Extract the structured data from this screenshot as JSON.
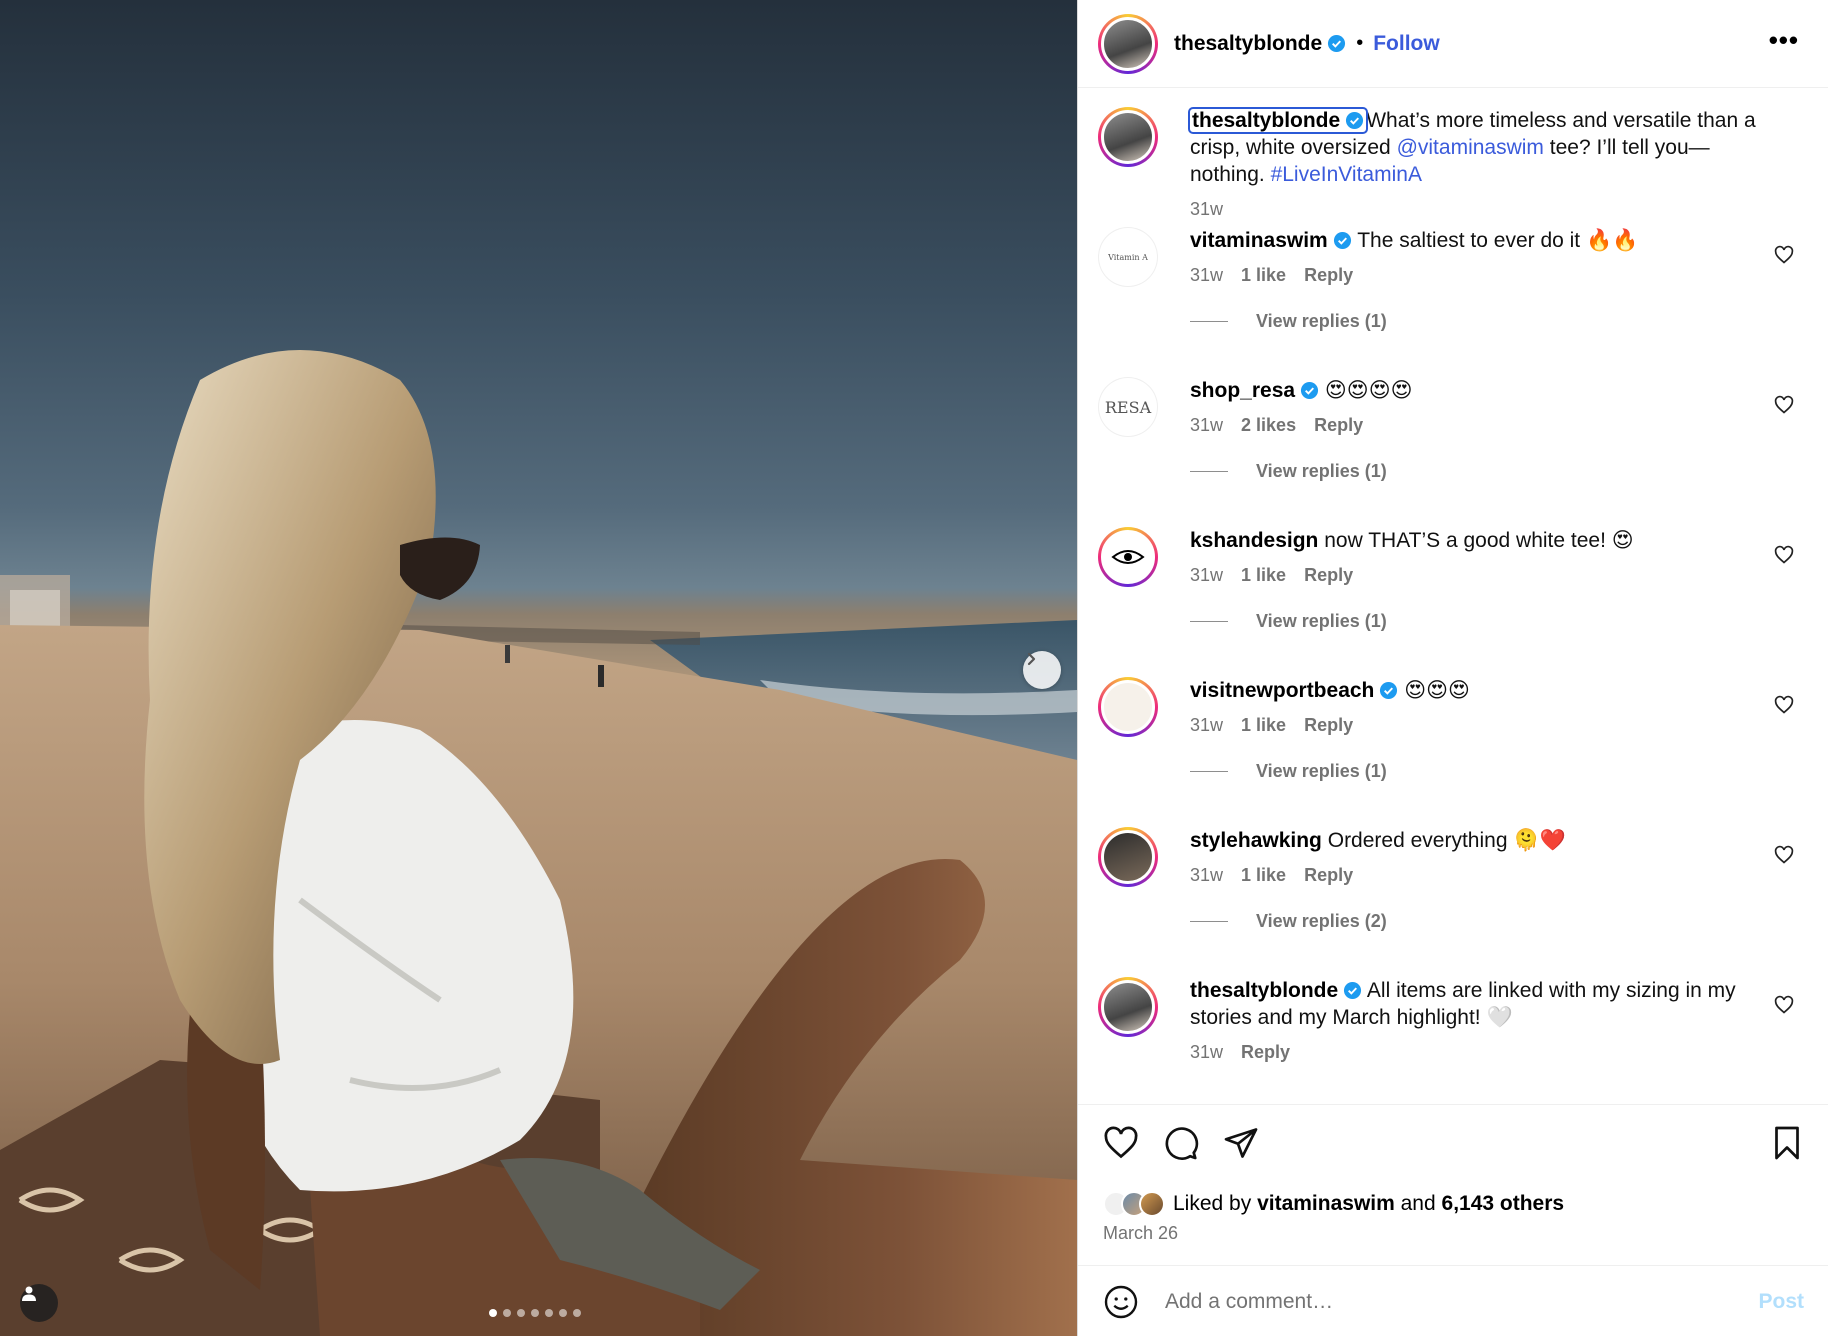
{
  "post": {
    "author": "thesaltyblonde",
    "follow_label": "Follow",
    "more_label": "•••",
    "bullet": "•",
    "caption": {
      "username": "thesaltyblonde",
      "text_before": "What’s more timeless and versatile than a crisp, white oversized ",
      "mention": "@vitaminaswim",
      "text_middle": " tee? I’ll tell you—nothing. ",
      "hashtag": "#LiveInVitaminA",
      "time": "31w"
    },
    "carousel": {
      "slides": 7,
      "active_index": 0
    }
  },
  "comments": [
    {
      "username": "vitaminaswim",
      "verified": true,
      "text": "The saltiest to ever do it 🔥🔥",
      "time": "31w",
      "likes": "1 like",
      "reply": "Reply",
      "replies": "View replies (1)",
      "avatar_text": "Vitamin A"
    },
    {
      "username": "shop_resa",
      "verified": true,
      "text": "😍😍😍😍",
      "time": "31w",
      "likes": "2 likes",
      "reply": "Reply",
      "replies": "View replies (1)",
      "avatar_text": "RESA"
    },
    {
      "username": "kshandesign",
      "verified": false,
      "text": "now THAT’S a good white tee! 😍",
      "time": "31w",
      "likes": "1 like",
      "reply": "Reply",
      "replies": "View replies (1)"
    },
    {
      "username": "visitnewportbeach",
      "verified": true,
      "text": "😍😍😍",
      "time": "31w",
      "likes": "1 like",
      "reply": "Reply",
      "replies": "View replies (1)"
    },
    {
      "username": "stylehawking",
      "verified": false,
      "text": "Ordered everything 🫠❤️",
      "time": "31w",
      "likes": "1 like",
      "reply": "Reply",
      "replies": "View replies (2)"
    },
    {
      "username": "thesaltyblonde",
      "verified": true,
      "text": "All items are linked with my sizing in my stories and my March highlight! 🤍",
      "time": "31w",
      "reply": "Reply"
    }
  ],
  "footer": {
    "liked_prefix": "Liked by ",
    "liked_user": "vitaminaswim",
    "liked_and": " and ",
    "liked_others": "6,143 others",
    "date": "March 26",
    "comment_placeholder": "Add a comment…",
    "post_label": "Post"
  },
  "colors": {
    "link": "#3b5bdb",
    "verified": "#1d9bf0",
    "muted": "#737373"
  }
}
